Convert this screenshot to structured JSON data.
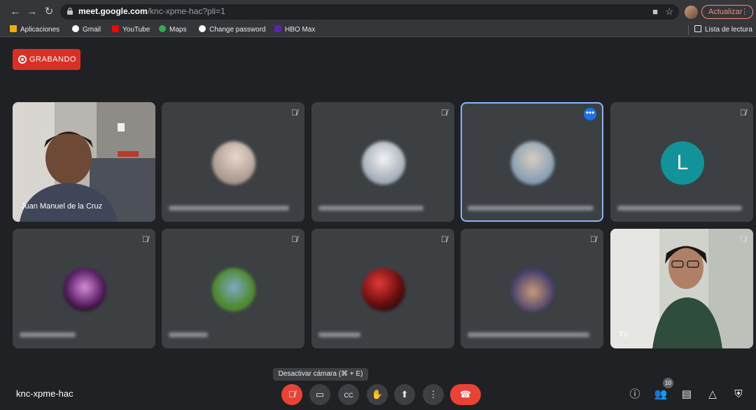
{
  "browser": {
    "url_host": "meet.google.com",
    "url_path": "/knc-xpme-hac?pli=1",
    "update_label": "Actualizar",
    "bookmarks": [
      {
        "label": "Aplicaciones",
        "icon": "apps-grid-icon",
        "color": "#f9ab00"
      },
      {
        "label": "Gmail",
        "icon": "google-icon",
        "color": "#ffffff"
      },
      {
        "label": "YouTube",
        "icon": "youtube-icon",
        "color": "#ff0000"
      },
      {
        "label": "Maps",
        "icon": "maps-pin-icon",
        "color": "#34a853"
      },
      {
        "label": "Change password",
        "icon": "globe-icon",
        "color": "#ffffff"
      },
      {
        "label": "HBO Max",
        "icon": "hbo-max-icon",
        "color": "#5822b4"
      }
    ],
    "reading_list_label": "Lista de lectura"
  },
  "recording": {
    "label": "GRABANDO"
  },
  "tiles": [
    {
      "name": "Juan Manuel de la Cruz",
      "type": "camera",
      "muted": false
    },
    {
      "name": "",
      "type": "avatar",
      "muted": true,
      "avatar_color": "#c8b8b0"
    },
    {
      "name": "",
      "type": "avatar",
      "muted": true,
      "avatar_color": "#d6dde6"
    },
    {
      "name": "",
      "type": "avatar",
      "muted": false,
      "active": true,
      "avatar_color": "#a7b8c9"
    },
    {
      "name": "",
      "type": "letter",
      "letter": "L",
      "muted": true,
      "avatar_color": "#12939a"
    },
    {
      "name": "",
      "type": "avatar",
      "muted": true,
      "avatar_color": "#7a3e8a"
    },
    {
      "name": "",
      "type": "avatar",
      "muted": true,
      "avatar_color": "#6b9a4a"
    },
    {
      "name": "",
      "type": "avatar",
      "muted": true,
      "avatar_color": "#a21818"
    },
    {
      "name": "",
      "type": "avatar",
      "muted": true,
      "avatar_color": "#8a6a5a"
    },
    {
      "name": "Tú",
      "type": "camera-self",
      "muted": true
    }
  ],
  "tooltip": {
    "text": "Desactivar cámara (⌘ + E)"
  },
  "meeting_code": "knc-xpme-hac",
  "participant_count": "10",
  "colors": {
    "background": "#202124",
    "tile": "#3c4043",
    "accent": "#1a73e8",
    "danger": "#ea4335",
    "active_border": "#8ab4f8"
  }
}
